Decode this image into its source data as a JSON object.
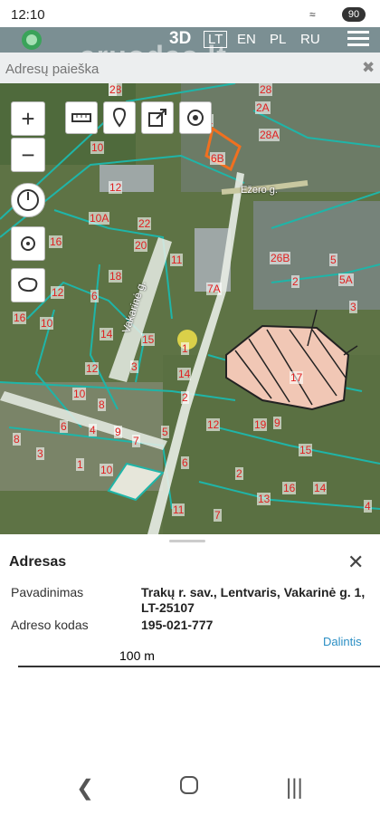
{
  "status": {
    "time": "12:10",
    "battery": "90"
  },
  "header": {
    "btn_3d": "3D",
    "languages": [
      "LT",
      "EN",
      "PL",
      "RU"
    ],
    "active_language": "LT",
    "watermark": "aruodas.lt"
  },
  "search": {
    "placeholder": "Adresų paieška",
    "value": ""
  },
  "map": {
    "scale_label": "100 m",
    "street_labels": [
      "Vakarinė g.",
      "Ežero g."
    ],
    "parcel_labels": [
      "28",
      "28",
      "2A",
      "28A",
      "10",
      "12",
      "6B",
      "22",
      "10A",
      "20",
      "16",
      "11",
      "18",
      "7A",
      "12",
      "6",
      "16",
      "10",
      "14",
      "1",
      "15",
      "3",
      "2",
      "14",
      "12",
      "10",
      "8",
      "6",
      "4",
      "9",
      "7",
      "5",
      "3",
      "1",
      "10",
      "8",
      "6",
      "2",
      "13",
      "16",
      "14",
      "12",
      "9",
      "11",
      "7",
      "19",
      "15",
      "17",
      "11",
      "26B",
      "2",
      "5",
      "5A",
      "3",
      "4",
      "2"
    ]
  },
  "panel": {
    "title": "Adresas",
    "name_label": "Pavadinimas",
    "name_value": "Trakų r. sav., Lentvaris, Vakarinė g. 1, LT-25107",
    "code_label": "Adreso kodas",
    "code_value": "195-021-777",
    "share_label": "Dalintis"
  },
  "colors": {
    "topbar": "#7b8f93",
    "parcel_line": "#1fb5a8",
    "label_red": "#e02020",
    "link": "#2b8fc4"
  }
}
